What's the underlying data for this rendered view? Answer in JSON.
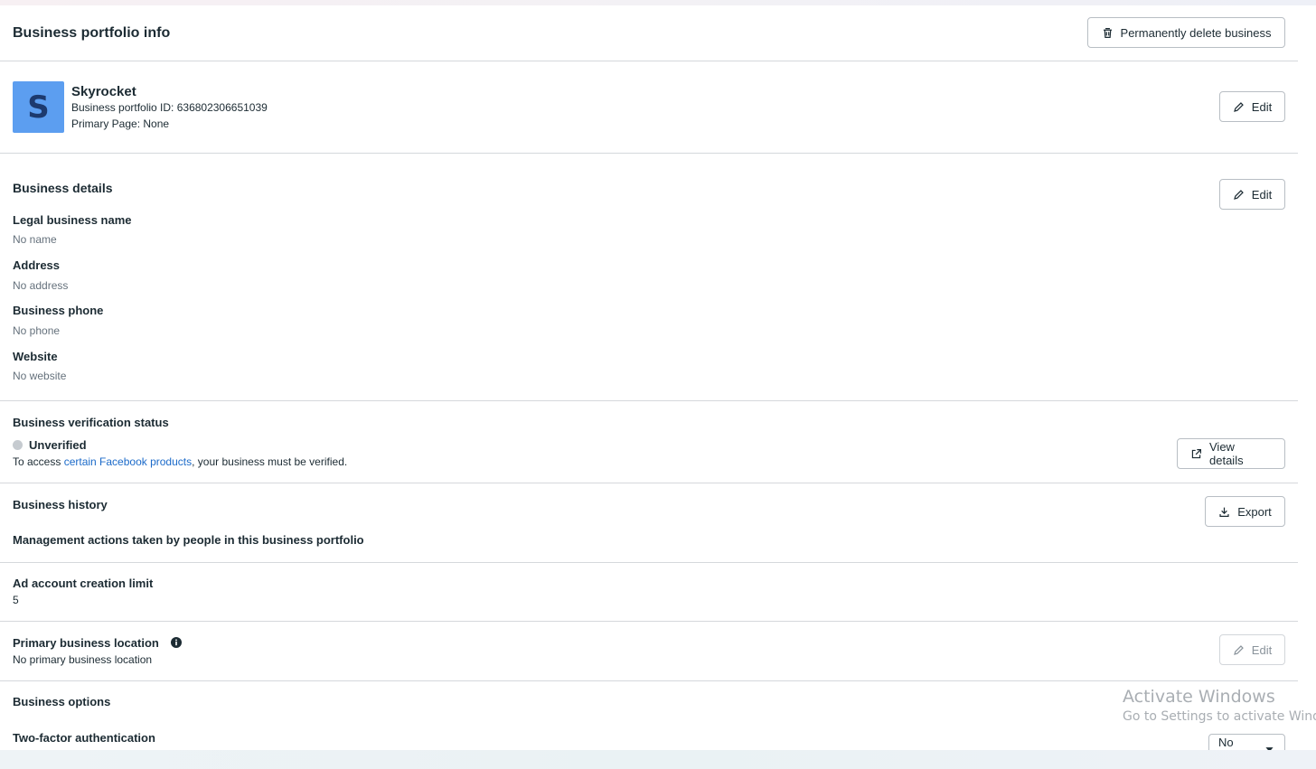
{
  "header": {
    "title": "Business portfolio info",
    "delete_button": "Permanently delete business"
  },
  "profile": {
    "avatar_letter": "S",
    "name": "Skyrocket",
    "portfolio_id_line": "Business portfolio ID: 636802306651039",
    "primary_page_line": "Primary Page: None",
    "edit_button": "Edit"
  },
  "business_details": {
    "title": "Business details",
    "edit_button": "Edit",
    "fields": [
      {
        "label": "Legal business name",
        "value": "No name"
      },
      {
        "label": "Address",
        "value": "No address"
      },
      {
        "label": "Business phone",
        "value": "No phone"
      },
      {
        "label": "Website",
        "value": "No website"
      }
    ]
  },
  "verification": {
    "title": "Business verification status",
    "status": "Unverified",
    "text_before": "To access ",
    "link_text": "certain Facebook products",
    "text_after": ", your business must be verified.",
    "view_details_button": "View details"
  },
  "history": {
    "title": "Business history",
    "export_button": "Export",
    "subtitle": "Management actions taken by people in this business portfolio"
  },
  "ad_limit": {
    "title": "Ad account creation limit",
    "value": "5"
  },
  "location": {
    "title": "Primary business location",
    "value": "No primary business location",
    "edit_button": "Edit"
  },
  "options": {
    "title": "Business options",
    "two_factor_title": "Two-factor authentication",
    "two_factor_select": "No one"
  },
  "watermark": {
    "line1": "Activate Windows",
    "line2": "Go to Settings to activate Windows."
  },
  "colors": {
    "link": "#1b6ac9",
    "avatar_bg": "#5c9ef0",
    "divider": "#d5d8dc"
  }
}
